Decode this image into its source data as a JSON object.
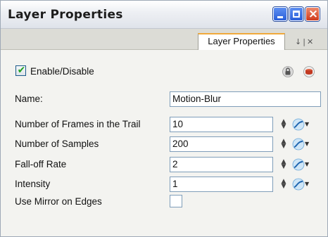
{
  "window": {
    "title": "Layer Properties"
  },
  "titlebar_buttons": {
    "minimize": "minimize",
    "maximize": "maximize",
    "close": "close"
  },
  "tab": {
    "label": "Layer Properties"
  },
  "tab_controls": {
    "arrow": "↓",
    "separator": "|",
    "close": "✕"
  },
  "enable": {
    "label": "Enable/Disable",
    "checked": true
  },
  "icons": {
    "lock": "lock-icon",
    "layer": "layer-color-icon"
  },
  "fields": {
    "name": {
      "label": "Name:",
      "value": "Motion-Blur"
    },
    "frames": {
      "label": "Number of Frames in the Trail",
      "value": "10"
    },
    "samples": {
      "label": "Number of Samples",
      "value": "200"
    },
    "falloff": {
      "label": "Fall-off Rate",
      "value": "2"
    },
    "intensity": {
      "label": "Intensity",
      "value": "1"
    },
    "mirror": {
      "label": "Use Mirror on Edges",
      "checked": false
    }
  },
  "colors": {
    "accent_tab": "#f0a93a",
    "check": "#21a121",
    "title_btn_blue": "#2a5fd9",
    "title_btn_close": "#cf3a1d"
  }
}
